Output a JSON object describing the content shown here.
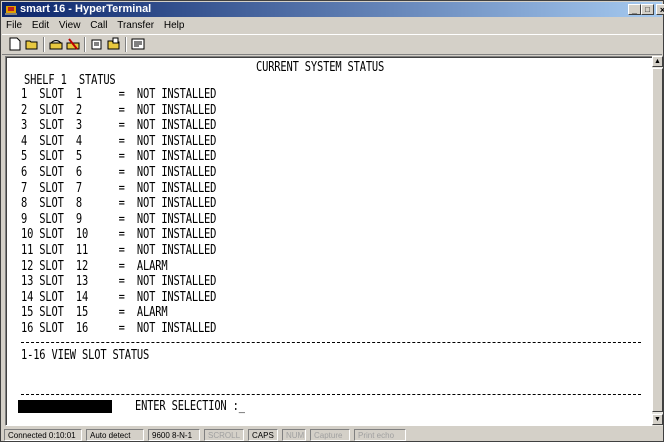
{
  "window": {
    "title": "smart 16 - HyperTerminal",
    "controls": {
      "minimize": "_",
      "maximize": "□",
      "close": "×"
    }
  },
  "menu": [
    "File",
    "Edit",
    "View",
    "Call",
    "Transfer",
    "Help"
  ],
  "toolbar": {
    "icons": [
      "new-icon",
      "open-icon",
      "call-icon",
      "disconnect-icon",
      "send-icon",
      "receive-icon",
      "properties-icon"
    ]
  },
  "terminal": {
    "title": "CURRENT SYSTEM STATUS",
    "header": "SHELF 1  STATUS",
    "rows": [
      "1  SLOT  1      =  NOT INSTALLED",
      "2  SLOT  2      =  NOT INSTALLED",
      "3  SLOT  3      =  NOT INSTALLED",
      "4  SLOT  4      =  NOT INSTALLED",
      "5  SLOT  5      =  NOT INSTALLED",
      "6  SLOT  6      =  NOT INSTALLED",
      "7  SLOT  7      =  NOT INSTALLED",
      "8  SLOT  8      =  NOT INSTALLED",
      "9  SLOT  9      =  NOT INSTALLED",
      "10 SLOT  10     =  NOT INSTALLED",
      "11 SLOT  11     =  NOT INSTALLED",
      "12 SLOT  12     =  ALARM",
      "13 SLOT  13     =  NOT INSTALLED",
      "14 SLOT  14     =  NOT INSTALLED",
      "15 SLOT  15     =  ALARM",
      "16 SLOT  16     =  NOT INSTALLED"
    ],
    "menu_option": "1-16 VIEW SLOT STATUS",
    "prompt": "ENTER SELECTION :_"
  },
  "statusbar": {
    "connected": "Connected 0:10:01",
    "detect": "Auto detect",
    "settings": "9600 8-N-1",
    "scroll": "SCROLL",
    "caps": "CAPS",
    "num": "NUM",
    "capture": "Capture",
    "echo": "Print echo"
  }
}
